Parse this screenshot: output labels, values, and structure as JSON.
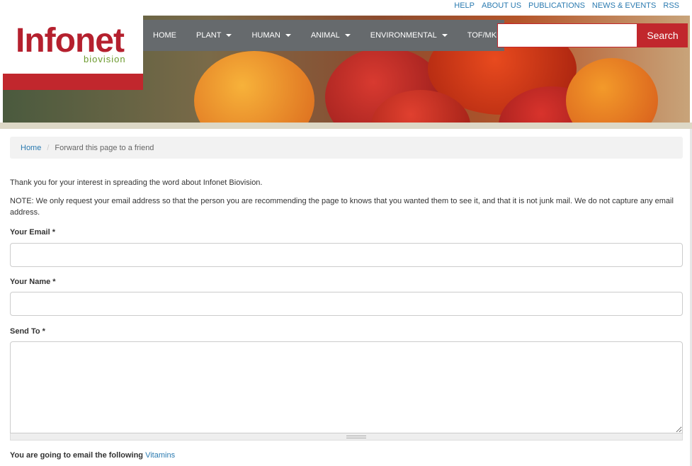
{
  "util_links": [
    "HELP",
    "ABOUT US",
    "PUBLICATIONS",
    "NEWS & EVENTS",
    "RSS"
  ],
  "logo": {
    "main": "Infonet",
    "sub": "biovision"
  },
  "nav": {
    "home": "HOME",
    "plant": "PLANT",
    "human": "HUMAN",
    "animal": "ANIMAL",
    "environmental": "ENVIRONMENTAL",
    "tof": "TOF/MKM"
  },
  "search": {
    "button": "Search",
    "value": ""
  },
  "breadcrumb": {
    "home": "Home",
    "separator": "/",
    "current": "Forward this page to a friend"
  },
  "intro": "Thank you for your interest in spreading the word about Infonet Biovision.",
  "note": "NOTE: We only request your email address so that the person you are recommending the page to knows that you wanted them to see it, and that it is not junk mail. We do not capture any email address.",
  "form": {
    "email_label": "Your Email *",
    "name_label": "Your Name *",
    "send_to_label": "Send To *"
  },
  "footer": {
    "prefix": "You are going to email the following",
    "link": "Vitamins"
  },
  "colors": {
    "brand_red": "#c1272d",
    "nav_gray": "#666a6d",
    "link_blue": "#2a7ab0",
    "logo_green": "#6c9a2e"
  }
}
